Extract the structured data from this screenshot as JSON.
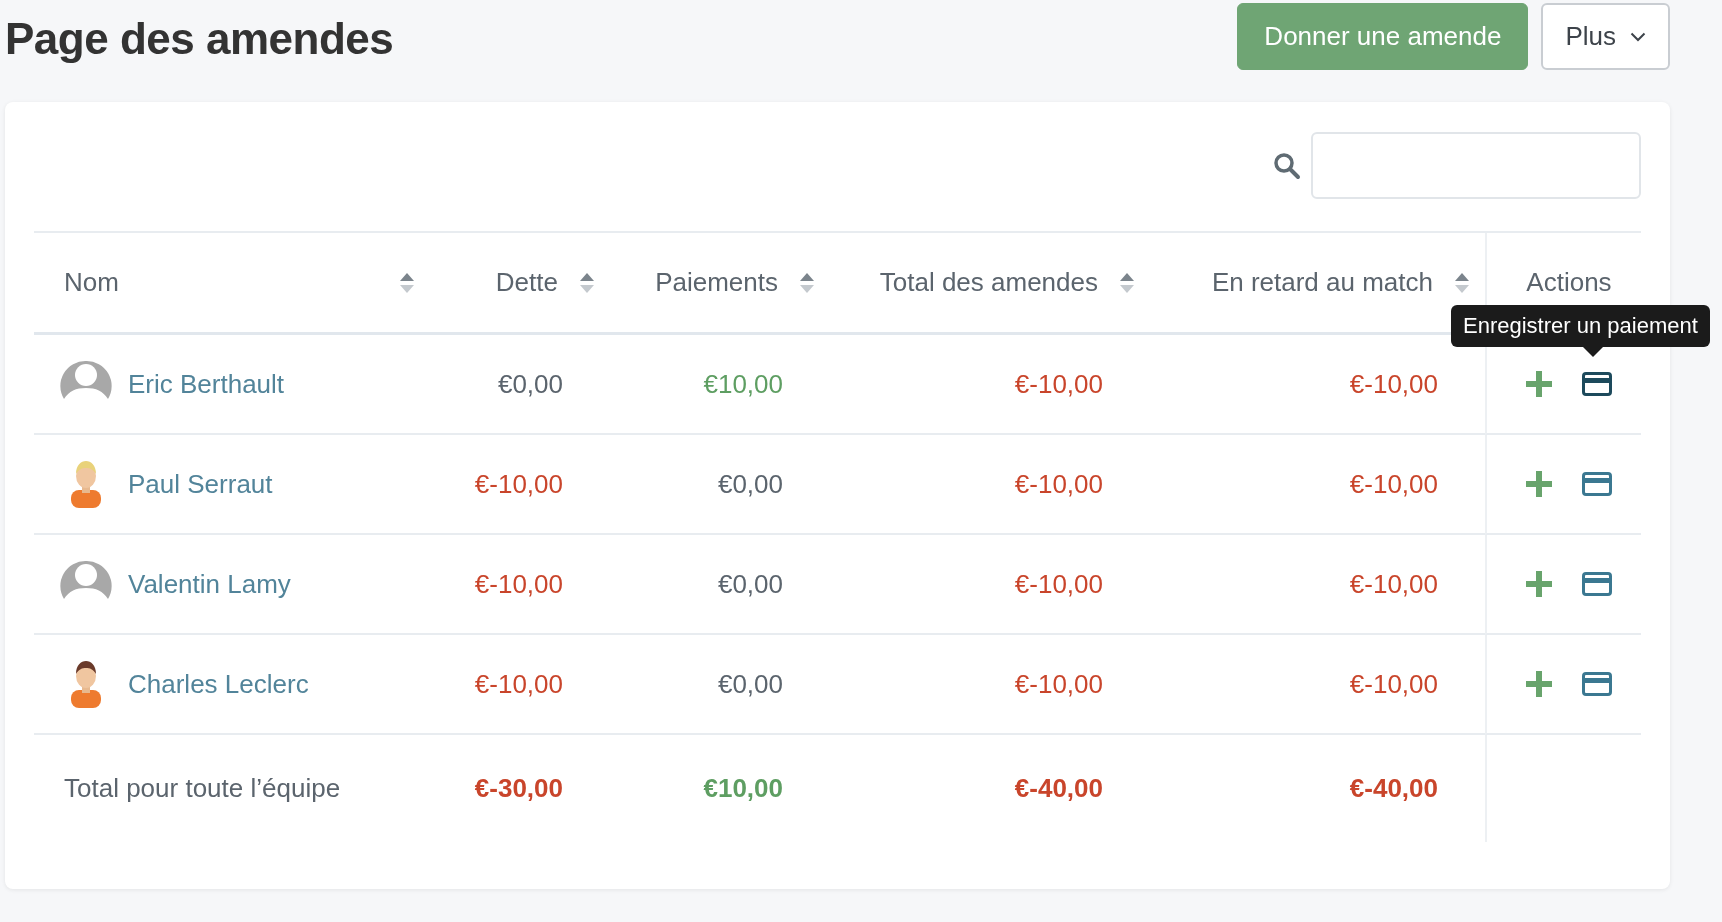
{
  "page_title": "Page des amendes",
  "header_buttons": [
    {
      "label": "Donner une amende",
      "kind": "primary"
    },
    {
      "label": "Plus",
      "kind": "dropdown"
    }
  ],
  "table": {
    "columns": [
      {
        "label": "Nom",
        "sortable": true
      },
      {
        "label": "Dette",
        "sortable": true
      },
      {
        "label": "Paiements",
        "sortable": true
      },
      {
        "label": "Total des amendes",
        "sortable": true
      },
      {
        "label": "En retard au match",
        "sortable": true
      },
      {
        "label": "Actions",
        "sortable": false
      }
    ],
    "rows": [
      {
        "avatar": {
          "kind": "silhouette"
        },
        "name": "Eric Berthault",
        "values": [
          {
            "text": "€0,00",
            "kind": "zero"
          },
          {
            "text": "€10,00",
            "kind": "positive"
          },
          {
            "text": "€-10,00",
            "kind": "negative"
          },
          {
            "text": "€-10,00",
            "kind": "negative"
          }
        ],
        "payment_hovered": true,
        "payment_tooltip": "Enregistrer un paiement"
      },
      {
        "avatar": {
          "kind": "player-blond"
        },
        "name": "Paul Serraut",
        "values": [
          {
            "text": "€-10,00",
            "kind": "negative"
          },
          {
            "text": "€0,00",
            "kind": "zero"
          },
          {
            "text": "€-10,00",
            "kind": "negative"
          },
          {
            "text": "€-10,00",
            "kind": "negative"
          }
        ],
        "payment_hovered": false
      },
      {
        "avatar": {
          "kind": "silhouette"
        },
        "name": "Valentin Lamy",
        "values": [
          {
            "text": "€-10,00",
            "kind": "negative"
          },
          {
            "text": "€0,00",
            "kind": "zero"
          },
          {
            "text": "€-10,00",
            "kind": "negative"
          },
          {
            "text": "€-10,00",
            "kind": "negative"
          }
        ],
        "payment_hovered": false
      },
      {
        "avatar": {
          "kind": "player-brown"
        },
        "name": "Charles Leclerc",
        "values": [
          {
            "text": "€-10,00",
            "kind": "negative"
          },
          {
            "text": "€0,00",
            "kind": "zero"
          },
          {
            "text": "€-10,00",
            "kind": "negative"
          },
          {
            "text": "€-10,00",
            "kind": "negative"
          }
        ],
        "payment_hovered": false
      }
    ],
    "total": {
      "label": "Total pour toute l’équipe",
      "values": [
        {
          "text": "€-30,00",
          "kind": "negative"
        },
        {
          "text": "€10,00",
          "kind": "positive"
        },
        {
          "text": "€-40,00",
          "kind": "negative"
        },
        {
          "text": "€-40,00",
          "kind": "negative"
        }
      ]
    }
  }
}
